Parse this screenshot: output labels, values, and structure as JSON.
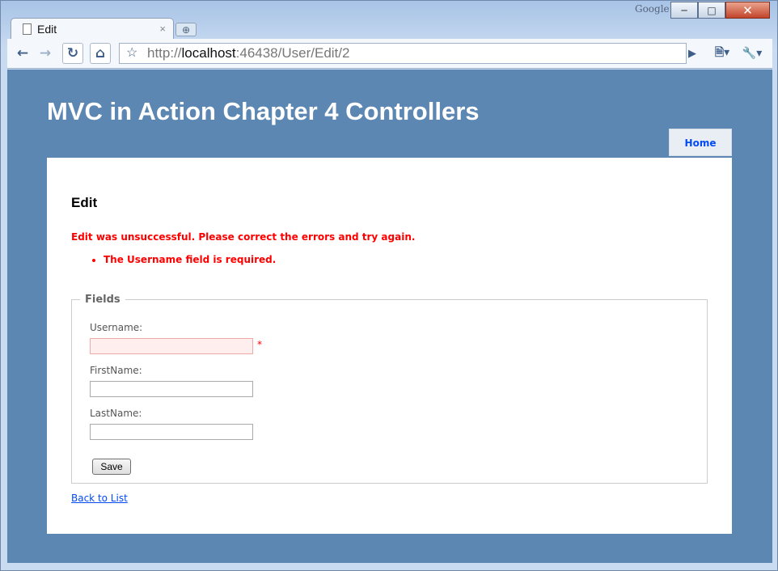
{
  "browser": {
    "brand": "Google",
    "tab_title": "Edit",
    "url_scheme": "http://",
    "url_host": "localhost",
    "url_rest": ":46438/User/Edit/2"
  },
  "site": {
    "title": "MVC in Action Chapter 4 Controllers",
    "menu": [
      {
        "label": "Home"
      }
    ]
  },
  "page": {
    "heading": "Edit",
    "error_summary": "Edit was unsuccessful. Please correct the errors and try again.",
    "errors": [
      "The Username field is required."
    ],
    "fieldset_legend": "Fields",
    "fields": [
      {
        "label": "Username:",
        "value": "",
        "invalid": true,
        "marker": "*"
      },
      {
        "label": "FirstName:",
        "value": "",
        "invalid": false
      },
      {
        "label": "LastName:",
        "value": "",
        "invalid": false
      }
    ],
    "save_label": "Save",
    "back_link": "Back to List"
  },
  "colors": {
    "page_background": "#5c87b2",
    "error_text": "#ff0000",
    "link": "#034af3",
    "invalid_input_bg": "#ffeeee"
  }
}
